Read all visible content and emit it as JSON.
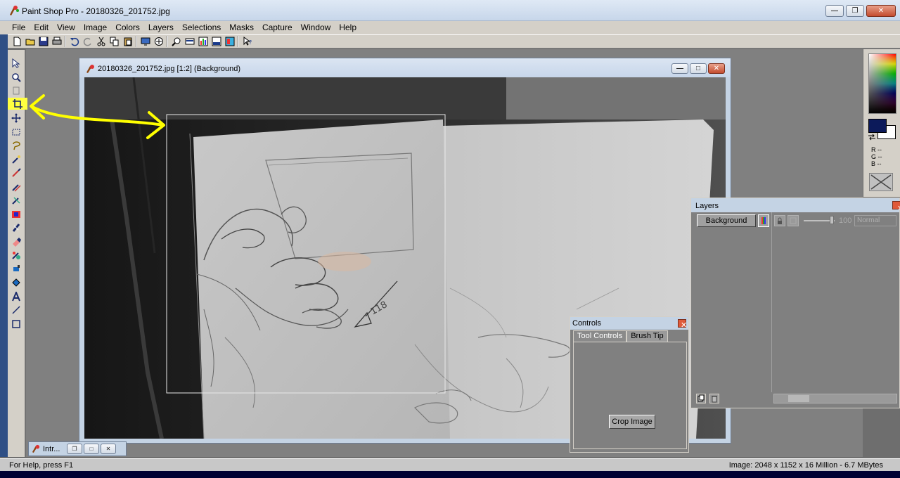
{
  "app": {
    "title": "Paint Shop Pro - 20180326_201752.jpg"
  },
  "menu": [
    "File",
    "Edit",
    "View",
    "Image",
    "Colors",
    "Layers",
    "Selections",
    "Masks",
    "Capture",
    "Window",
    "Help"
  ],
  "toolbar": {
    "icons": [
      "new-icon",
      "open-icon",
      "save-icon",
      "print-icon",
      "undo-icon",
      "redo-icon",
      "cut-icon",
      "copy-icon",
      "paste-icon",
      "full-screen-icon",
      "browse-icon",
      "zoom-icon",
      "toolbar-icon",
      "histogram-icon",
      "color-palette-icon",
      "layers-palette-icon",
      "context-help-icon"
    ]
  },
  "tools": [
    "arrow-tool-icon",
    "zoom-tool-icon",
    "deform-tool-icon",
    "crop-tool-icon",
    "mover-tool-icon",
    "selection-tool-icon",
    "freehand-tool-icon",
    "dropper-tool-icon",
    "paint-brush-tool-icon",
    "clone-brush-tool-icon",
    "color-replacer-tool-icon",
    "retouch-tool-icon",
    "scratch-remover-tool-icon",
    "eraser-tool-icon",
    "picture-tube-tool-icon",
    "airbrush-tool-icon",
    "flood-fill-tool-icon",
    "text-tool-icon",
    "draw-tool-icon",
    "preset-shapes-tool-icon"
  ],
  "image_window": {
    "title": "20180326_201752.jpg [1:2] (Background)"
  },
  "controls_panel": {
    "title": "Controls",
    "tabs": [
      "Tool Controls",
      "Brush Tip"
    ],
    "crop_button": "Crop Image"
  },
  "layers_panel": {
    "title": "Layers",
    "layer_name": "Background",
    "opacity": "100",
    "blend_mode": "Normal"
  },
  "color_palette": {
    "rgb_lines": [
      "R --",
      "G --",
      "B --"
    ],
    "foreground": "#0c1a5a",
    "background": "#ffffff"
  },
  "minimized_window": {
    "title": "Intr..."
  },
  "status": {
    "help": "For Help, press F1",
    "image_info": "Image:  2048 x 1152 x 16 Million - 6.7 MBytes"
  },
  "annotation": {
    "highlight_color": "#ffff00"
  }
}
